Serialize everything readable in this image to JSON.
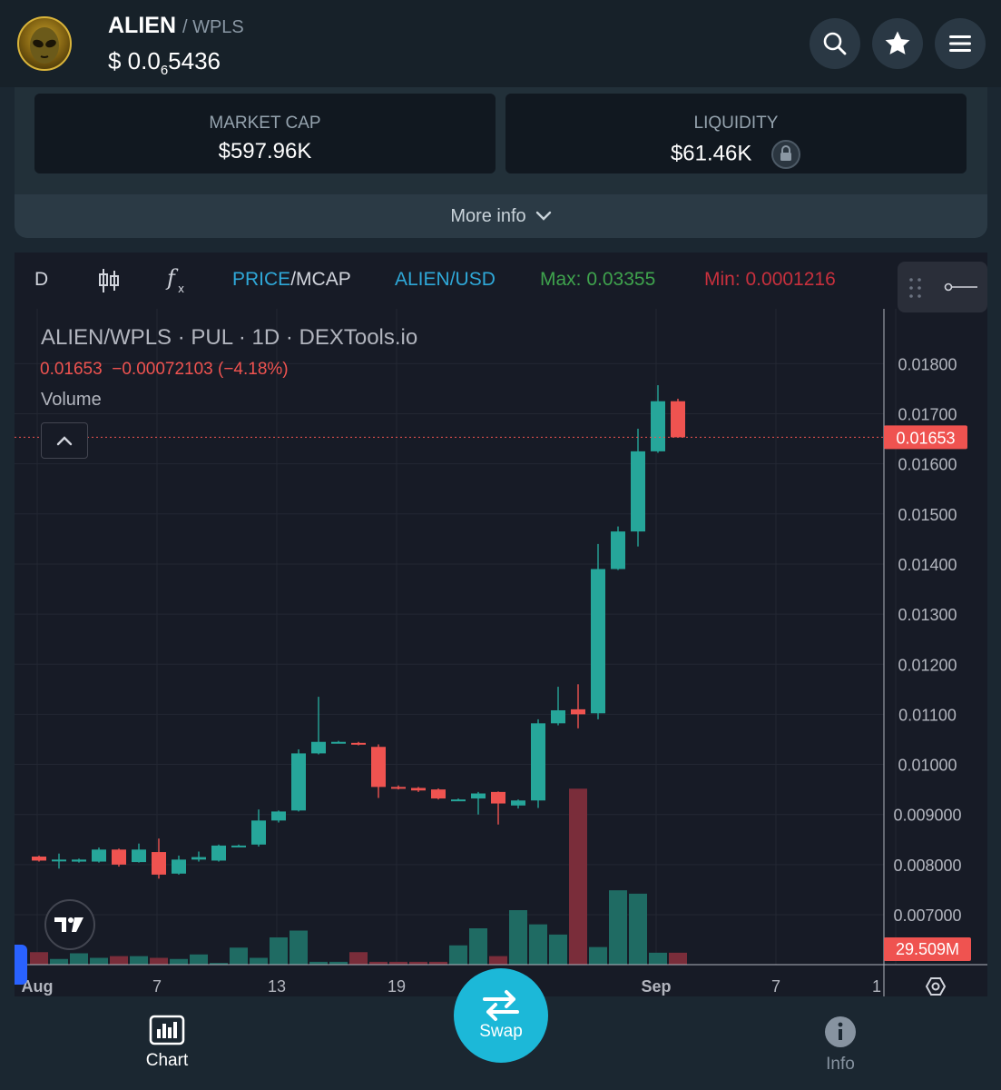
{
  "header": {
    "base_symbol": "ALIEN",
    "quote_symbol": "/ WPLS",
    "price_prefix": "$ 0.0",
    "price_zeros": "6",
    "price_rest": "5436"
  },
  "stats": {
    "market_cap_label": "MARKET CAP",
    "market_cap_value": "$597.96K",
    "liquidity_label": "LIQUIDITY",
    "liquidity_value": "$61.46K",
    "more_info": "More info"
  },
  "toolbar": {
    "interval": "D",
    "price_label": "PRICE",
    "mcap_label": "MCAP",
    "pair_usd": "ALIEN/USD",
    "max_label": "Max: 0.03355",
    "min_label": "Min: 0.0001216"
  },
  "legend": {
    "title": "ALIEN/WPLS · PUL · 1D · DEXTools.io",
    "ohlc_close": "0.01653",
    "ohlc_change": "−0.00072103 (−4.18%)",
    "volume_label": "Volume"
  },
  "colors": {
    "up": "#26a69a",
    "down": "#ef5350",
    "accent": "#1cb8d8",
    "max": "#3fa34d",
    "min": "#c8303d"
  },
  "chart_data": {
    "type": "candlestick",
    "title": "ALIEN/WPLS · PUL · 1D · DEXTools.io",
    "x_tick_labels": [
      "Aug",
      "7",
      "13",
      "19",
      "Sep",
      "7",
      "1"
    ],
    "y_tick_labels": [
      "0.01800",
      "0.01700",
      "0.01600",
      "0.01500",
      "0.01400",
      "0.01300",
      "0.01200",
      "0.01100",
      "0.01000",
      "0.009000",
      "0.008000",
      "0.007000"
    ],
    "last_price_label": "0.01653",
    "last_volume_label": "29.509M",
    "ylim": [
      0.0065,
      0.0185
    ],
    "candles": [
      {
        "o": 0.00816,
        "h": 0.00818,
        "l": 0.00806,
        "c": 0.00808
      },
      {
        "o": 0.00808,
        "h": 0.00822,
        "l": 0.00792,
        "c": 0.0081
      },
      {
        "o": 0.00806,
        "h": 0.00812,
        "l": 0.00804,
        "c": 0.0081
      },
      {
        "o": 0.00806,
        "h": 0.00834,
        "l": 0.00804,
        "c": 0.0083
      },
      {
        "o": 0.0083,
        "h": 0.00832,
        "l": 0.00796,
        "c": 0.008
      },
      {
        "o": 0.00805,
        "h": 0.00842,
        "l": 0.00804,
        "c": 0.0083
      },
      {
        "o": 0.00825,
        "h": 0.00852,
        "l": 0.00772,
        "c": 0.0078
      },
      {
        "o": 0.00782,
        "h": 0.00818,
        "l": 0.0078,
        "c": 0.0081
      },
      {
        "o": 0.0081,
        "h": 0.00826,
        "l": 0.00806,
        "c": 0.00815
      },
      {
        "o": 0.00808,
        "h": 0.0084,
        "l": 0.00806,
        "c": 0.00838
      },
      {
        "o": 0.00838,
        "h": 0.0084,
        "l": 0.00836,
        "c": 0.00838
      },
      {
        "o": 0.0084,
        "h": 0.0091,
        "l": 0.00836,
        "c": 0.00888
      },
      {
        "o": 0.00888,
        "h": 0.00908,
        "l": 0.00884,
        "c": 0.00906
      },
      {
        "o": 0.00908,
        "h": 0.0103,
        "l": 0.00906,
        "c": 0.01022
      },
      {
        "o": 0.01022,
        "h": 0.01135,
        "l": 0.0102,
        "c": 0.01045
      },
      {
        "o": 0.01045,
        "h": 0.01047,
        "l": 0.01043,
        "c": 0.01045
      },
      {
        "o": 0.01043,
        "h": 0.01045,
        "l": 0.01038,
        "c": 0.0104
      },
      {
        "o": 0.01035,
        "h": 0.0104,
        "l": 0.00933,
        "c": 0.00955
      },
      {
        "o": 0.00955,
        "h": 0.00958,
        "l": 0.0095,
        "c": 0.00953
      },
      {
        "o": 0.00953,
        "h": 0.00955,
        "l": 0.00945,
        "c": 0.00948
      },
      {
        "o": 0.0095,
        "h": 0.00952,
        "l": 0.0093,
        "c": 0.00932
      },
      {
        "o": 0.0093,
        "h": 0.00932,
        "l": 0.00928,
        "c": 0.0093
      },
      {
        "o": 0.00932,
        "h": 0.00945,
        "l": 0.009,
        "c": 0.00942
      },
      {
        "o": 0.00945,
        "h": 0.00946,
        "l": 0.0088,
        "c": 0.00922
      },
      {
        "o": 0.00918,
        "h": 0.0093,
        "l": 0.00912,
        "c": 0.00928
      },
      {
        "o": 0.00928,
        "h": 0.0109,
        "l": 0.00913,
        "c": 0.01082
      },
      {
        "o": 0.01082,
        "h": 0.01155,
        "l": 0.01078,
        "c": 0.01108
      },
      {
        "o": 0.0111,
        "h": 0.0116,
        "l": 0.01072,
        "c": 0.011
      },
      {
        "o": 0.01102,
        "h": 0.0144,
        "l": 0.0109,
        "c": 0.0139
      },
      {
        "o": 0.0139,
        "h": 0.01475,
        "l": 0.01388,
        "c": 0.01465
      },
      {
        "o": 0.01465,
        "h": 0.0167,
        "l": 0.01435,
        "c": 0.01625
      },
      {
        "o": 0.01625,
        "h": 0.01757,
        "l": 0.01622,
        "c": 0.01725
      },
      {
        "o": 0.01725,
        "h": 0.0173,
        "l": 0.01653,
        "c": 0.01653
      }
    ],
    "volume": [
      2.2,
      1.0,
      2.0,
      1.2,
      1.5,
      1.5,
      1.2,
      1.0,
      1.8,
      0.3,
      3.0,
      1.2,
      4.8,
      6.0,
      0.5,
      0.5,
      2.2,
      0.5,
      0.5,
      0.5,
      0.5,
      3.4,
      6.4,
      1.5,
      9.6,
      7.1,
      5.3,
      31.0,
      3.1,
      13.1,
      12.5,
      2.1,
      2.1
    ],
    "volume_ylim": [
      0,
      32
    ]
  },
  "bottom_nav": {
    "chart_label": "Chart",
    "swap_label": "Swap",
    "info_label": "Info"
  }
}
